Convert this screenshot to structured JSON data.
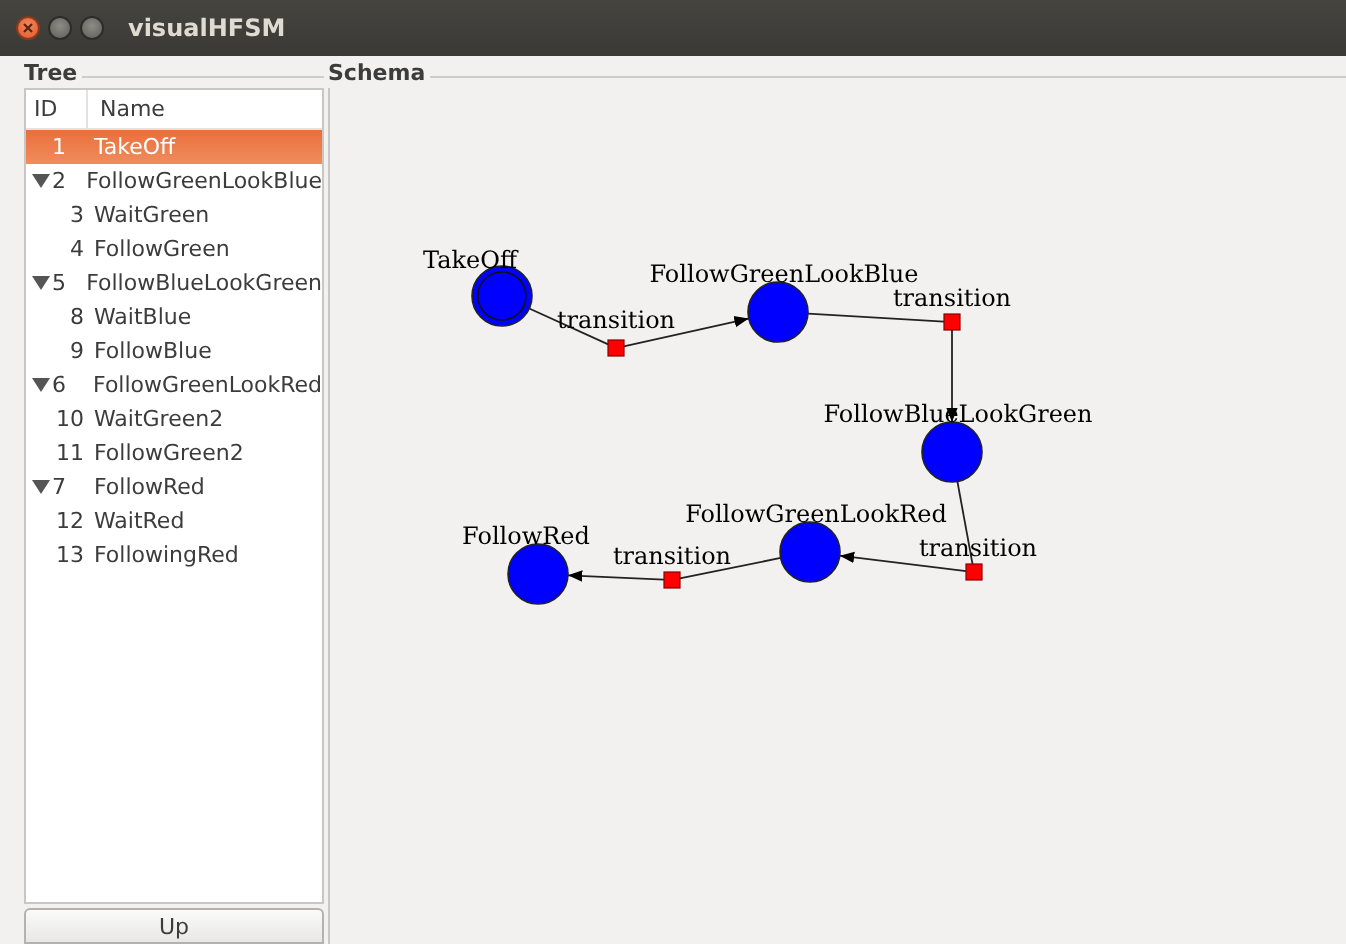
{
  "window": {
    "title": "visualHFSM"
  },
  "tree": {
    "title": "Tree",
    "columns": [
      "ID",
      "Name"
    ],
    "rows": [
      {
        "id": "1",
        "name": "TakeOff",
        "selected": true
      },
      {
        "id": "2",
        "name": "FollowGreenLookBlue",
        "selected": false,
        "expanded": true,
        "children": [
          {
            "id": "3",
            "name": "WaitGreen",
            "selected": false
          },
          {
            "id": "4",
            "name": "FollowGreen",
            "selected": false
          }
        ]
      },
      {
        "id": "5",
        "name": "FollowBlueLookGreen",
        "selected": false,
        "expanded": true,
        "children": [
          {
            "id": "8",
            "name": "WaitBlue",
            "selected": false
          },
          {
            "id": "9",
            "name": "FollowBlue",
            "selected": false
          }
        ]
      },
      {
        "id": "6",
        "name": "FollowGreenLookRed",
        "selected": false,
        "expanded": true,
        "children": [
          {
            "id": "10",
            "name": "WaitGreen2",
            "selected": false
          },
          {
            "id": "11",
            "name": "FollowGreen2",
            "selected": false
          }
        ]
      },
      {
        "id": "7",
        "name": "FollowRed",
        "selected": false,
        "expanded": true,
        "children": [
          {
            "id": "12",
            "name": "WaitRed",
            "selected": false
          },
          {
            "id": "13",
            "name": "FollowingRed",
            "selected": false
          }
        ]
      }
    ],
    "button": "Up"
  },
  "schema": {
    "title": "Schema",
    "states": [
      {
        "name": "TakeOff",
        "initial": true
      },
      {
        "name": "FollowGreenLookBlue",
        "initial": false
      },
      {
        "name": "FollowBlueLookGreen",
        "initial": false
      },
      {
        "name": "FollowGreenLookRed",
        "initial": false
      },
      {
        "name": "FollowRed",
        "initial": false
      }
    ],
    "transitions": [
      {
        "label": "transition"
      },
      {
        "label": "transition"
      },
      {
        "label": "transition"
      },
      {
        "label": "transition"
      }
    ]
  }
}
